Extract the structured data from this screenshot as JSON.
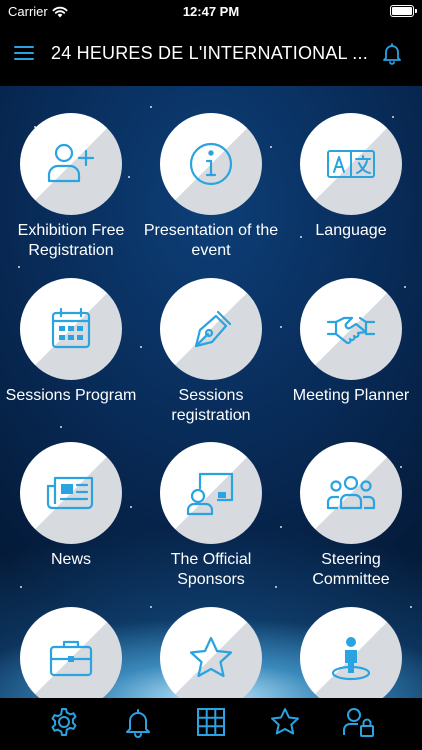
{
  "status_bar": {
    "carrier": "Carrier",
    "time": "12:47 PM"
  },
  "header": {
    "title": "24 HEURES DE L'INTERNATIONAL ..."
  },
  "tiles": [
    {
      "label": "Exhibition Free Registration",
      "icon": "add-user-icon"
    },
    {
      "label": "Presentation of the event",
      "icon": "info-icon"
    },
    {
      "label": "Language",
      "icon": "translate-icon"
    },
    {
      "label": "Sessions Program",
      "icon": "calendar-icon"
    },
    {
      "label": "Sessions registration",
      "icon": "pen-nib-icon"
    },
    {
      "label": "Meeting Planner",
      "icon": "handshake-icon"
    },
    {
      "label": "News",
      "icon": "newspaper-icon"
    },
    {
      "label": "The Official Sponsors",
      "icon": "presentation-board-icon"
    },
    {
      "label": "Steering Committee",
      "icon": "group-icon"
    },
    {
      "label": "",
      "icon": "briefcase-icon"
    },
    {
      "label": "",
      "icon": "star-icon"
    },
    {
      "label": "",
      "icon": "location-person-icon"
    }
  ],
  "tab_bar": {
    "icons": [
      "gear-icon",
      "bell-icon",
      "grid-icon",
      "star-icon",
      "user-lock-icon"
    ]
  },
  "colors": {
    "accent": "#2aa3e0",
    "circle_fill": "#ffffff",
    "circle_shade": "#d7dade"
  }
}
